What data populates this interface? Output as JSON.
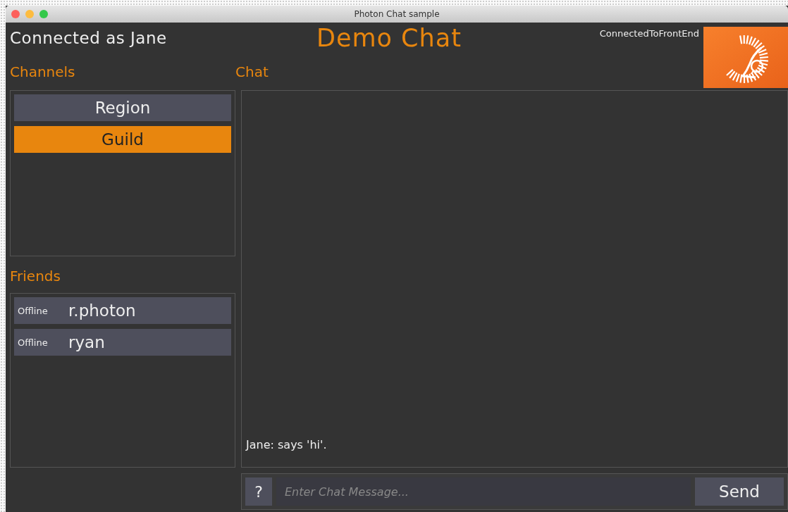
{
  "window": {
    "title": "Photon Chat sample"
  },
  "header": {
    "user_status": "Connected as Jane",
    "title": "Demo Chat",
    "connection_state": "ConnectedToFrontEnd"
  },
  "channels": {
    "heading": "Channels",
    "items": [
      {
        "label": "Region",
        "selected": false
      },
      {
        "label": "Guild",
        "selected": true
      }
    ]
  },
  "friends": {
    "heading": "Friends",
    "items": [
      {
        "status": "Offline",
        "name": "r.photon"
      },
      {
        "status": "Offline",
        "name": "ryan"
      }
    ]
  },
  "chat": {
    "heading": "Chat",
    "messages": [
      "Jane: says 'hi'."
    ],
    "input": {
      "placeholder": "Enter Chat Message..."
    },
    "help_button": "?",
    "send_button": "Send"
  }
}
